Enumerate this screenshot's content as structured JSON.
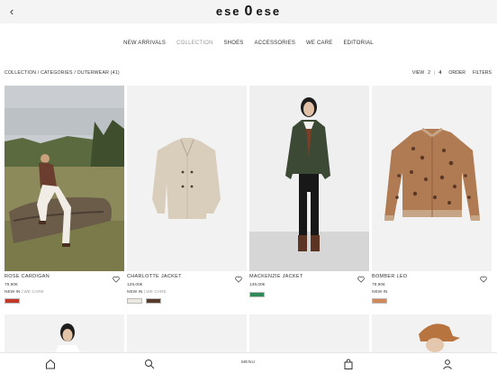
{
  "header": {
    "back_glyph": "‹",
    "logo_left": "ese",
    "logo_mid": "0",
    "logo_right": "ese"
  },
  "nav": {
    "items": [
      {
        "label": "NEW ARRIVALS",
        "active": false
      },
      {
        "label": "COLLECTION",
        "active": true
      },
      {
        "label": "SHOES",
        "active": false
      },
      {
        "label": "ACCESSORIES",
        "active": false
      },
      {
        "label": "WE CARE",
        "active": false
      },
      {
        "label": "EDITORIAL",
        "active": false
      }
    ]
  },
  "breadcrumb": {
    "text": "COLLECTION / CATEGORIES / OUTERWEAR",
    "count": "(41)"
  },
  "controls": {
    "view_label": "VIEW",
    "view_2": "2",
    "view_sep": "|",
    "view_4": "4",
    "order_label": "ORDER",
    "filters_label": "FILTERS"
  },
  "products": [
    {
      "name": "ROSE CARDIGAN",
      "price": "79,90€",
      "tag1": "NEW IN",
      "tag2": "WE CARE",
      "swatches": [
        "#c0392b"
      ]
    },
    {
      "name": "CHARLOTTE JACKET",
      "price": "129,00€",
      "tag1": "NEW IN",
      "tag2": "WE CARE",
      "swatches": [
        "#ece8e0",
        "#5a3a2a"
      ]
    },
    {
      "name": "MACKENZIE JACKET",
      "price": "139,00€",
      "tag1": "",
      "tag2": "",
      "swatches": [
        "#2f8a57"
      ]
    },
    {
      "name": "BOMBER LEO",
      "price": "79,90€",
      "tag1": "NEW IN",
      "tag2": "",
      "swatches": [
        "#d08a5a"
      ]
    }
  ],
  "tabbar": {
    "menu_label": "MENU"
  },
  "colors": {
    "topbar_bg": "#f4f4f4",
    "active_nav": "#999999",
    "text": "#222222"
  }
}
